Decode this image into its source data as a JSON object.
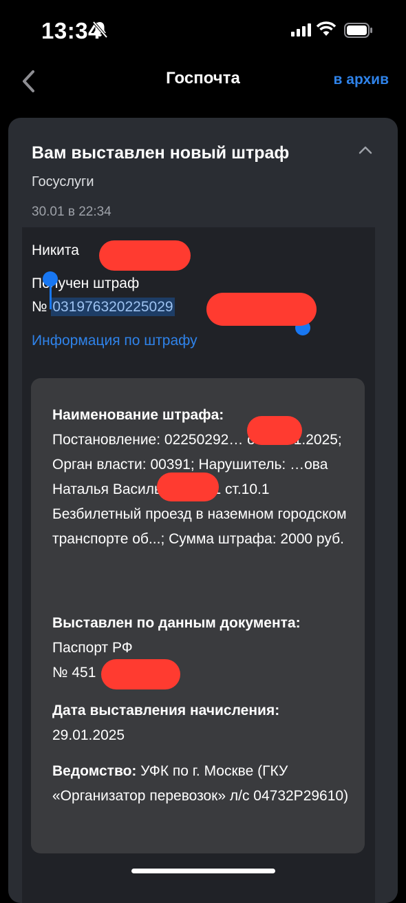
{
  "status_bar": {
    "time": "13:34"
  },
  "nav": {
    "title": "Госпочта",
    "archive": "в архив"
  },
  "message": {
    "title": "Вам выставлен новый штраф",
    "sender": "Госуслуги",
    "date": "30.01 в 22:34",
    "greeting": "Никита",
    "fine_received": "Получен штраф",
    "number_prefix": "№",
    "fine_number": "031976320225029",
    "info_link": "Информация по штрафу",
    "details": {
      "name_label": "Наименование штрафа:",
      "name_value": "Постановление: 02250292… от 29.01.2025; Орган власти: 00391; Нарушитель: …ова Наталья Васильевна; ч.1 ст.10.1 Безбилетный проезд в наземном городском транспорте об...; Сумма штрафа: 2000 руб.",
      "doc_label": "Выставлен по данным документа:",
      "doc_value": "Паспорт РФ",
      "doc_number": "№ 451",
      "accrual_label": "Дата выставления начисления:",
      "accrual_value": "29.01.2025",
      "agency_label": "Ведомство:",
      "agency_value": "УФК по г. Москве (ГКУ «Организатор перевозок» л/с 04732Р29610)"
    }
  },
  "colors": {
    "accent": "#2f83ea",
    "card": "#2a2d33",
    "details_bg": "#3a3b3e",
    "redaction": "#ff3b30",
    "selection": "#1877f2"
  },
  "icons": [
    "bell-slash-icon",
    "signal-icon",
    "wifi-icon",
    "battery-icon",
    "chevron-left-icon",
    "chevron-up-icon"
  ]
}
